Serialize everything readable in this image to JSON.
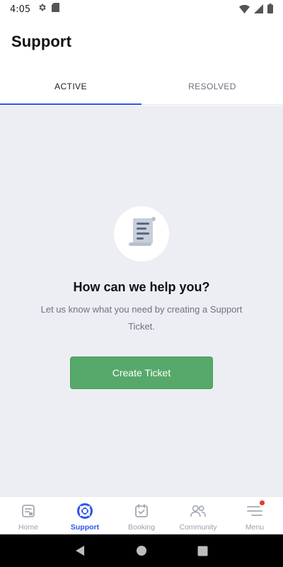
{
  "status_bar": {
    "time": "4:05",
    "icons": [
      "gear-icon",
      "sd-card-icon",
      "wifi-icon",
      "signal-icon",
      "battery-icon"
    ]
  },
  "header": {
    "title": "Support"
  },
  "tabs": [
    {
      "label": "ACTIVE",
      "active": true
    },
    {
      "label": "RESOLVED",
      "active": false
    }
  ],
  "empty_state": {
    "icon": "document-scroll-icon",
    "title": "How can we help you?",
    "subtitle": "Let us know what you need by creating a Support Ticket.",
    "button_label": "Create Ticket"
  },
  "bottom_nav": [
    {
      "label": "Home",
      "icon": "home-icon",
      "active": false
    },
    {
      "label": "Support",
      "icon": "lifebuoy-icon",
      "active": true
    },
    {
      "label": "Booking",
      "icon": "calendar-check-icon",
      "active": false
    },
    {
      "label": "Community",
      "icon": "people-icon",
      "active": false
    },
    {
      "label": "Menu",
      "icon": "menu-icon",
      "active": false
    }
  ],
  "colors": {
    "accent": "#2f54eb",
    "button": "#56a96a",
    "content_bg": "#eceef3",
    "notification": "#e53935"
  }
}
